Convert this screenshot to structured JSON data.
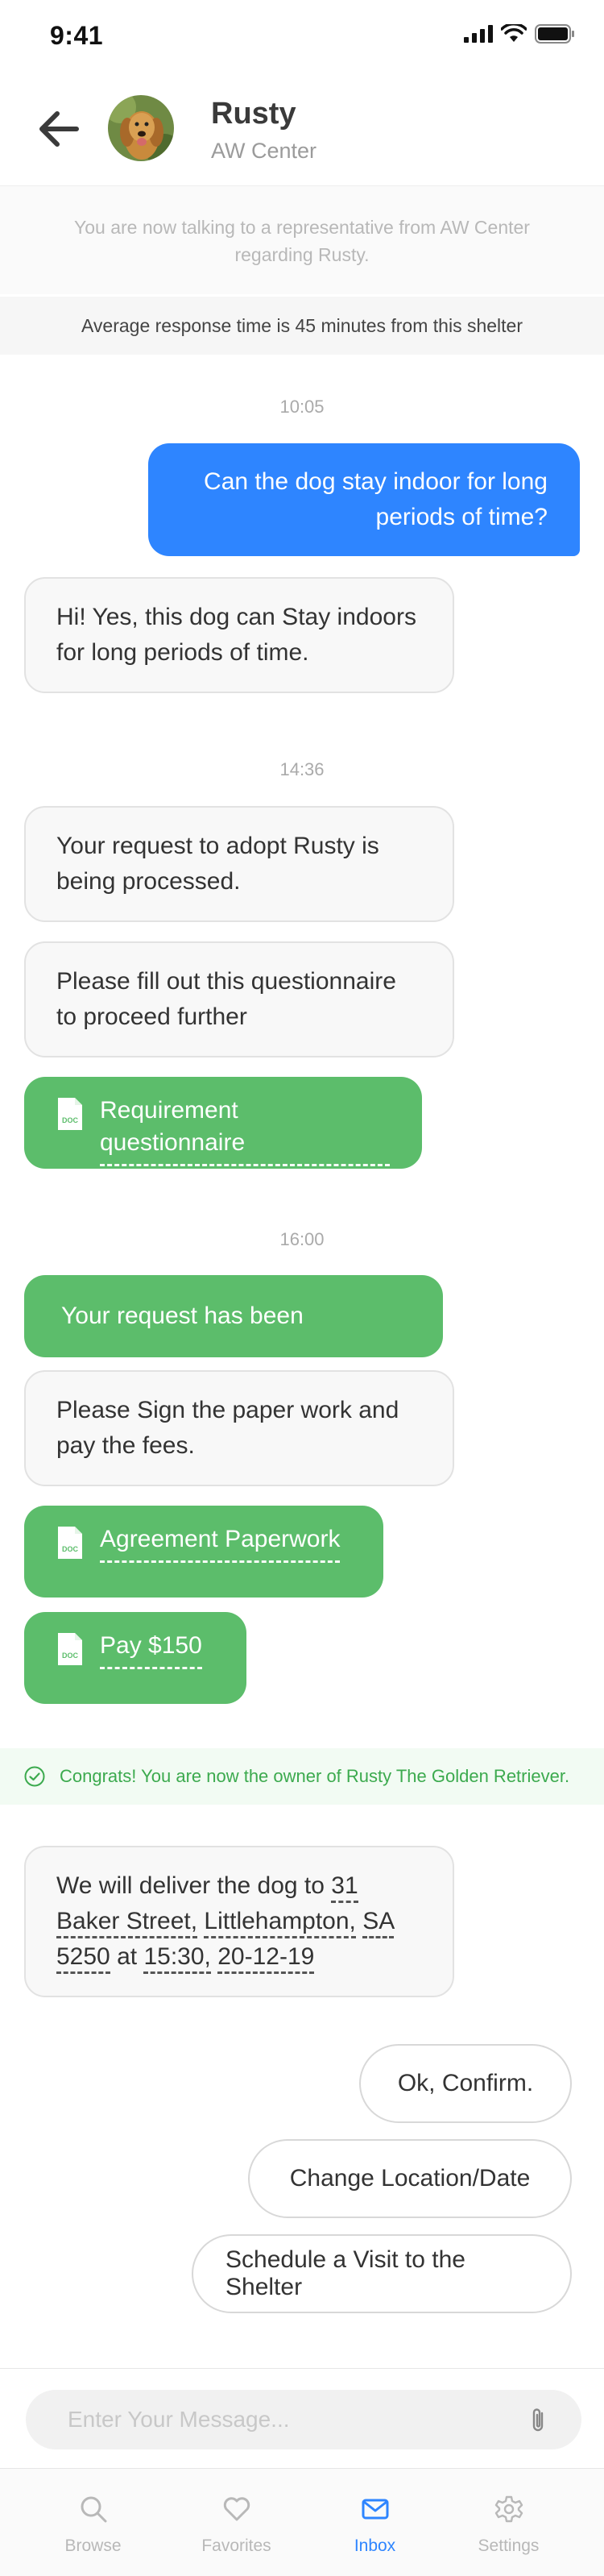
{
  "status_bar": {
    "time": "9:41"
  },
  "header": {
    "back_icon": "arrow-left-icon",
    "dog_name": "Rusty",
    "center_name": "AW Center"
  },
  "info": {
    "notice": "You are now talking to a representative from AW Center regarding Rusty.",
    "response_time": "Average response time is 45 minutes from this shelter"
  },
  "messages": {
    "time_1": "10:05",
    "sent_1": "Can the dog stay indoor for long periods of time?",
    "received_1": "Hi! Yes, this dog can Stay indoors for long periods of time.",
    "time_2": "14:36",
    "received_2": "Your request to adopt Rusty is being processed.",
    "received_3": "Please fill out this questionnaire to proceed further",
    "doc_1": "Requirement questionnaire",
    "time_3": "16:00",
    "accepted": "Your request has been accepted",
    "received_4": "Please Sign the paper work and pay the fees.",
    "doc_2": "Agreement Paperwork",
    "doc_3": "Pay $150",
    "congrats": "Congrats! You are now the owner of Rusty The Golden Retriever.",
    "delivery": {
      "prefix": "We will deliver the dog to ",
      "address_1": "31",
      "address_2": "Baker Street,",
      "address_3": "Littlehampton,",
      "address_4": "SA",
      "address_5": "5250",
      "at": " at ",
      "time": "15:30,",
      "date": "20-12-19"
    }
  },
  "quick_replies": {
    "confirm": "Ok, Confirm.",
    "change": "Change Location/Date",
    "visit": "Schedule a Visit to the Shelter"
  },
  "composer": {
    "placeholder": "Enter Your Message..."
  },
  "tabbar": {
    "browse": "Browse",
    "favorites": "Favorites",
    "inbox": "Inbox",
    "settings": "Settings"
  },
  "colors": {
    "accent_blue": "#2e85ff",
    "accent_green": "#5cbd6b",
    "congrats_text": "#3caa4e"
  }
}
